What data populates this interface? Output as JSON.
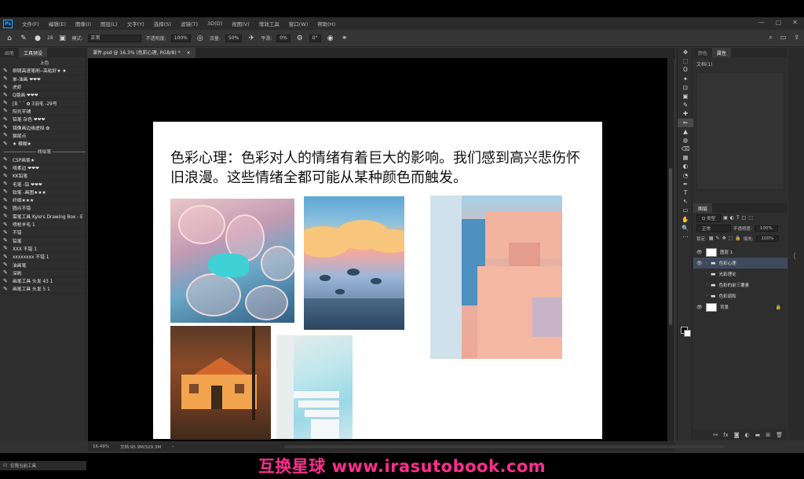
{
  "menu": [
    "文件(F)",
    "编辑(E)",
    "图像(I)",
    "图层(L)",
    "文字(Y)",
    "选择(S)",
    "滤镜(T)",
    "3D(D)",
    "视图(V)",
    "增效工具",
    "窗口(W)",
    "帮助(H)"
  ],
  "window_controls": [
    "—",
    "▢",
    "✕"
  ],
  "options": {
    "brush_size": "28",
    "mode_label": "模式:",
    "mode_value": "正常",
    "opacity_label": "不透明度:",
    "opacity_value": "100%",
    "flow_label": "流量:",
    "flow_value": "50%",
    "smooth_label": "平滑:",
    "smooth_value": "0%",
    "angle_value": "0°"
  },
  "left_panel": {
    "tabs": [
      "画笔",
      "工具预设"
    ],
    "presets": [
      "上色",
      "柳镜高速笔刷--高粘好★ ★",
      "单-油画 ❤❤❤",
      "虎虾",
      "Q版画 ❤❤❤",
      "[B ` ` ✿ 3羽毛 -29号",
      "阳光平铺",
      "铅笔 杂色 ❤❤❤",
      "镜像画边缘虚拟 ✿",
      "猫尾点",
      "★ 模糊★",
      "-------------------- 线绘笔 --------------------",
      "CSP画笔★",
      "啃柔边 ❤❤❤",
      "KK铅笔",
      "毛笔 -铅 ❤❤❤",
      "软笔 -画图★★★",
      "纤细★★★",
      "圆点不错",
      "需笔工具 Kyle's Drawing Box - E",
      "喷枪羊毛 1",
      "不错",
      "铅笔",
      "XXX 不错 1",
      "xxxxxxxx 不错 1",
      "油画笔",
      "深刷",
      "画笔工具 头发 43 1",
      "画笔工具 头发 5 1"
    ],
    "footer": "仅限当前工具"
  },
  "document": {
    "tab_label": "课件.psd @ 16.3% (色彩心理, RGB/8) *",
    "close": "✕",
    "status_zoom": "16.49%",
    "status_doc": "文档:95.9M/329.3M",
    "slide_text": "色彩心理：色彩对人的情绪有着巨大的影响。我们感到高兴悲伤怀旧浪漫。这些情绪全都可能从某种颜色而触发。"
  },
  "tools": [
    "✥",
    "⬚",
    "ʘ",
    "✦",
    "⊡",
    "▣",
    "✎",
    "✚",
    "✏",
    "▲",
    "◍",
    "⌫",
    "▦",
    "◐",
    "◔",
    "✒",
    "T",
    "↖",
    "▭",
    "✋",
    "🔍",
    "⋯"
  ],
  "right_panel": {
    "top_tabs": [
      "颜色",
      "属性"
    ],
    "props_title": "文档(1)",
    "layers_tab": "图层",
    "filter_kind": "Q 类型",
    "blend_mode": "正常",
    "opacity_label": "不透明度:",
    "opacity_value": "100%",
    "lock_label": "锁定:",
    "fill_label": "填充:",
    "fill_value": "100%",
    "layers": [
      {
        "name": "图层 1",
        "type": "pixel",
        "visible": true,
        "selected": false
      },
      {
        "name": "色彩心理",
        "type": "group",
        "visible": true,
        "selected": true
      },
      {
        "name": "光影理论",
        "type": "group",
        "visible": false,
        "selected": false
      },
      {
        "name": "色彩的前三要素",
        "type": "group",
        "visible": false,
        "selected": false
      },
      {
        "name": "色彩调和",
        "type": "group",
        "visible": false,
        "selected": false
      },
      {
        "name": "背景",
        "type": "pixel",
        "visible": true,
        "selected": false,
        "locked": true
      }
    ]
  },
  "watermark": "互换星球 www.irasutobook.com"
}
